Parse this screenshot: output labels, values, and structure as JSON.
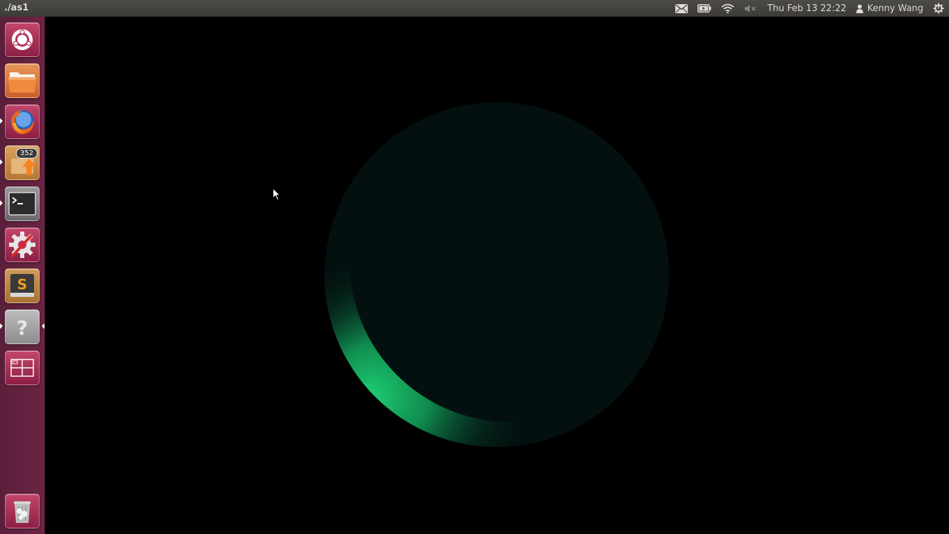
{
  "top_panel": {
    "window_title": "./as1",
    "clock": "Thu Feb 13 22:22",
    "user_name": "Kenny Wang",
    "icons": [
      "mail-icon",
      "battery-icon",
      "wifi-icon",
      "volume-muted-icon",
      "user-icon",
      "session-gear-icon"
    ]
  },
  "launcher": {
    "items": [
      {
        "name": "dash-home",
        "icon": "ubuntu-logo-icon",
        "running": false
      },
      {
        "name": "files",
        "icon": "folder-icon",
        "running": false
      },
      {
        "name": "firefox",
        "icon": "firefox-icon",
        "running": true
      },
      {
        "name": "update-manager",
        "icon": "update-manager-icon",
        "running": true,
        "badge": "352"
      },
      {
        "name": "terminal",
        "icon": "terminal-icon",
        "running": true
      },
      {
        "name": "system-settings",
        "icon": "settings-icon",
        "running": false
      },
      {
        "name": "sublime-text",
        "icon": "sublime-text-icon",
        "running": false
      },
      {
        "name": "unknown-app",
        "icon": "question-mark-icon",
        "running": true,
        "focused": true
      },
      {
        "name": "workspace-switcher",
        "icon": "workspace-switcher-icon",
        "running": false
      },
      {
        "name": "trash",
        "icon": "trash-icon",
        "running": false
      }
    ]
  },
  "scene": {
    "background_color": "#000000",
    "sphere_color": "#03100f",
    "highlight_color": "#1ed377"
  },
  "colors": {
    "launcher_bg": "#6b2444",
    "panel_bg": "#3c3b37",
    "panel_text": "#dfdbd2"
  }
}
